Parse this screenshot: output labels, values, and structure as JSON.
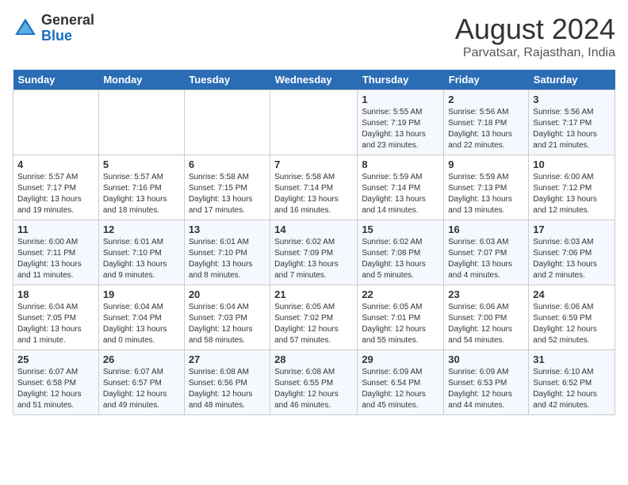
{
  "logo": {
    "general": "General",
    "blue": "Blue"
  },
  "title": {
    "month_year": "August 2024",
    "location": "Parvatsar, Rajasthan, India"
  },
  "days_of_week": [
    "Sunday",
    "Monday",
    "Tuesday",
    "Wednesday",
    "Thursday",
    "Friday",
    "Saturday"
  ],
  "weeks": [
    [
      {
        "day": "",
        "info": ""
      },
      {
        "day": "",
        "info": ""
      },
      {
        "day": "",
        "info": ""
      },
      {
        "day": "",
        "info": ""
      },
      {
        "day": "1",
        "info": "Sunrise: 5:55 AM\nSunset: 7:19 PM\nDaylight: 13 hours and 23 minutes."
      },
      {
        "day": "2",
        "info": "Sunrise: 5:56 AM\nSunset: 7:18 PM\nDaylight: 13 hours and 22 minutes."
      },
      {
        "day": "3",
        "info": "Sunrise: 5:56 AM\nSunset: 7:17 PM\nDaylight: 13 hours and 21 minutes."
      }
    ],
    [
      {
        "day": "4",
        "info": "Sunrise: 5:57 AM\nSunset: 7:17 PM\nDaylight: 13 hours and 19 minutes."
      },
      {
        "day": "5",
        "info": "Sunrise: 5:57 AM\nSunset: 7:16 PM\nDaylight: 13 hours and 18 minutes."
      },
      {
        "day": "6",
        "info": "Sunrise: 5:58 AM\nSunset: 7:15 PM\nDaylight: 13 hours and 17 minutes."
      },
      {
        "day": "7",
        "info": "Sunrise: 5:58 AM\nSunset: 7:14 PM\nDaylight: 13 hours and 16 minutes."
      },
      {
        "day": "8",
        "info": "Sunrise: 5:59 AM\nSunset: 7:14 PM\nDaylight: 13 hours and 14 minutes."
      },
      {
        "day": "9",
        "info": "Sunrise: 5:59 AM\nSunset: 7:13 PM\nDaylight: 13 hours and 13 minutes."
      },
      {
        "day": "10",
        "info": "Sunrise: 6:00 AM\nSunset: 7:12 PM\nDaylight: 13 hours and 12 minutes."
      }
    ],
    [
      {
        "day": "11",
        "info": "Sunrise: 6:00 AM\nSunset: 7:11 PM\nDaylight: 13 hours and 11 minutes."
      },
      {
        "day": "12",
        "info": "Sunrise: 6:01 AM\nSunset: 7:10 PM\nDaylight: 13 hours and 9 minutes."
      },
      {
        "day": "13",
        "info": "Sunrise: 6:01 AM\nSunset: 7:10 PM\nDaylight: 13 hours and 8 minutes."
      },
      {
        "day": "14",
        "info": "Sunrise: 6:02 AM\nSunset: 7:09 PM\nDaylight: 13 hours and 7 minutes."
      },
      {
        "day": "15",
        "info": "Sunrise: 6:02 AM\nSunset: 7:08 PM\nDaylight: 13 hours and 5 minutes."
      },
      {
        "day": "16",
        "info": "Sunrise: 6:03 AM\nSunset: 7:07 PM\nDaylight: 13 hours and 4 minutes."
      },
      {
        "day": "17",
        "info": "Sunrise: 6:03 AM\nSunset: 7:06 PM\nDaylight: 13 hours and 2 minutes."
      }
    ],
    [
      {
        "day": "18",
        "info": "Sunrise: 6:04 AM\nSunset: 7:05 PM\nDaylight: 13 hours and 1 minute."
      },
      {
        "day": "19",
        "info": "Sunrise: 6:04 AM\nSunset: 7:04 PM\nDaylight: 13 hours and 0 minutes."
      },
      {
        "day": "20",
        "info": "Sunrise: 6:04 AM\nSunset: 7:03 PM\nDaylight: 12 hours and 58 minutes."
      },
      {
        "day": "21",
        "info": "Sunrise: 6:05 AM\nSunset: 7:02 PM\nDaylight: 12 hours and 57 minutes."
      },
      {
        "day": "22",
        "info": "Sunrise: 6:05 AM\nSunset: 7:01 PM\nDaylight: 12 hours and 55 minutes."
      },
      {
        "day": "23",
        "info": "Sunrise: 6:06 AM\nSunset: 7:00 PM\nDaylight: 12 hours and 54 minutes."
      },
      {
        "day": "24",
        "info": "Sunrise: 6:06 AM\nSunset: 6:59 PM\nDaylight: 12 hours and 52 minutes."
      }
    ],
    [
      {
        "day": "25",
        "info": "Sunrise: 6:07 AM\nSunset: 6:58 PM\nDaylight: 12 hours and 51 minutes."
      },
      {
        "day": "26",
        "info": "Sunrise: 6:07 AM\nSunset: 6:57 PM\nDaylight: 12 hours and 49 minutes."
      },
      {
        "day": "27",
        "info": "Sunrise: 6:08 AM\nSunset: 6:56 PM\nDaylight: 12 hours and 48 minutes."
      },
      {
        "day": "28",
        "info": "Sunrise: 6:08 AM\nSunset: 6:55 PM\nDaylight: 12 hours and 46 minutes."
      },
      {
        "day": "29",
        "info": "Sunrise: 6:09 AM\nSunset: 6:54 PM\nDaylight: 12 hours and 45 minutes."
      },
      {
        "day": "30",
        "info": "Sunrise: 6:09 AM\nSunset: 6:53 PM\nDaylight: 12 hours and 44 minutes."
      },
      {
        "day": "31",
        "info": "Sunrise: 6:10 AM\nSunset: 6:52 PM\nDaylight: 12 hours and 42 minutes."
      }
    ]
  ]
}
